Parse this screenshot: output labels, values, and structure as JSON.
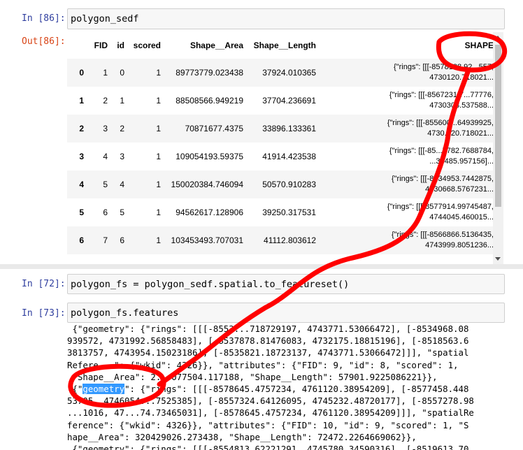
{
  "cells": [
    {
      "prompt": "In [86]:",
      "code": "polygon_sedf"
    },
    {
      "prompt": "In [72]:",
      "code": "polygon_fs = polygon_sedf.spatial.to_featureset()"
    },
    {
      "prompt": "In [73]:",
      "code": "polygon_fs.features"
    }
  ],
  "output_prompt": "Out[86]:",
  "table": {
    "columns": [
      "",
      "FID",
      "id",
      "scored",
      "Shape__Area",
      "Shape__Length",
      "SHAPE"
    ],
    "rows": [
      {
        "idx": "0",
        "fid": "1",
        "id": "0",
        "scored": "1",
        "area": "89773779.023438",
        "length": "37924.010365",
        "shape1": "{\"rings\": [[[-8578188.92...557,",
        "shape2": "4730120.718021..."
      },
      {
        "idx": "1",
        "fid": "2",
        "id": "1",
        "scored": "1",
        "area": "88508566.949219",
        "length": "37704.236691",
        "shape1": "{\"rings\": [[[-8567231.7...77776,",
        "shape2": "4730303.537588..."
      },
      {
        "idx": "2",
        "fid": "3",
        "id": "2",
        "scored": "1",
        "area": "70871677.4375",
        "length": "33896.133361",
        "shape1": "{\"rings\": [[[-855600...64939925,",
        "shape2": "4730...20.718021..."
      },
      {
        "idx": "3",
        "fid": "4",
        "id": "3",
        "scored": "1",
        "area": "109054193.59375",
        "length": "41914.423538",
        "shape1": "{\"rings\": [[[-85...7782.7688784,",
        "shape2": "...30485.957156]..."
      },
      {
        "idx": "4",
        "fid": "5",
        "id": "4",
        "scored": "1",
        "area": "150020384.746094",
        "length": "50570.910283",
        "shape1": "{\"rings\": [[[-8534953.7442875,",
        "shape2": "4730668.5767231..."
      },
      {
        "idx": "5",
        "fid": "6",
        "id": "5",
        "scored": "1",
        "area": "94562617.128906",
        "length": "39250.317531",
        "shape1": "{\"rings\": [[[-8577914.99745487,",
        "shape2": "4744045.460015..."
      },
      {
        "idx": "6",
        "fid": "7",
        "id": "6",
        "scored": "1",
        "area": "103453493.707031",
        "length": "41112.803612",
        "shape1": "{\"rings\": [[[-8566866.5136435,",
        "shape2": "4743999.8051236..."
      }
    ]
  },
  "features_output": {
    "line1": " {\"geometry\": {\"rings\": [[[-8553...718729197, 4743771.53066472], [-8534968.08",
    "line2": "939572, 4731992.56858483], [-8537878.81476083, 4732175.18815196], [-8518563.6",
    "line3": "3813757, 4743954.15023186], [-8535821.18723137, 4743771.53066472]]], \"spatial",
    "line4": "Refere...\": {\"wkid\": 4326}}, \"attributes\": {\"FID\": 9, \"id\": 8, \"scored\": 1,",
    "line5": " \"Shape__Area\": 2...077504.117188, \"Shape__Length\": 57901.9225086221}},",
    "line6_pre": " {\"",
    "line6_hl": "geometry",
    "line6_post": "\": {\"rings\": [[[-8578645.4757234, 4761120.38954209], [-8577458.448",
    "line7": "53705, 4746054...7525385], [-8557324.64126095, 4745232.48720177], [-8557278.98",
    "line8": "...1016, 47...74.73465031], [-8578645.4757234, 4761120.38954209]]], \"spatialRe",
    "line9": "ference\": {\"wkid\": 4326}}, \"attributes\": {\"FID\": 10, \"id\": 9, \"scored\": 1, \"S",
    "line10": "hape__Area\": 320429026.273438, \"Shape__Length\": 72472.2264669062}},",
    "line11": " {\"geometry\": {\"rings\": [[[-8554813.62221291, 4745780.34590316], [-8519613.70"
  },
  "colors": {
    "annotation": "#ff0000",
    "in_prompt": "#303f9f",
    "out_prompt": "#d84315",
    "selection": "#3399ff"
  }
}
